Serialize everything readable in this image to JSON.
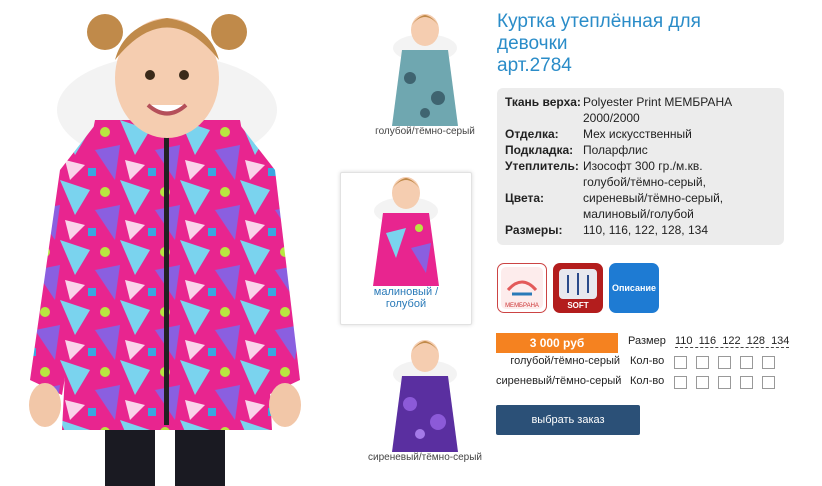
{
  "product": {
    "title_line1": "Куртка утеплённая для",
    "title_line2": "девочки",
    "article": "арт.2784"
  },
  "specs": [
    {
      "key": "Ткань верха:",
      "value": "Polyester Print МЕМБРАНА 2000/2000"
    },
    {
      "key": "Отделка:",
      "value": "Мех искусственный"
    },
    {
      "key": "Подкладка:",
      "value": "Поларфлис"
    },
    {
      "key": "Утеплитель:",
      "value": "Изософт 300 гр./м.кв."
    },
    {
      "key": "Цвета:",
      "value": "голубой/тёмно-серый, сиреневый/тёмно-серый, малиновый/голубой"
    },
    {
      "key": "Размеры:",
      "value": "110, 116, 122, 128, 134"
    }
  ],
  "thumbnails": [
    {
      "caption": "голубой/тёмно-серый",
      "icon": "jacket-blue-grey-photo"
    },
    {
      "caption": "малиновый / голубой",
      "icon": "jacket-raspberry-photo"
    },
    {
      "caption": "сиреневый/тёмно-серый",
      "icon": "jacket-lilac-photo"
    }
  ],
  "badges": {
    "membrana": "МЕМБРАНА",
    "isosoft": "SOFT",
    "description": "Описание"
  },
  "order": {
    "price": "3 000 руб",
    "size_label": "Размер",
    "sizes": [
      "110",
      "116",
      "122",
      "128",
      "134"
    ],
    "rows": [
      {
        "color": "голубой/тёмно-серый",
        "qty_label": "Кол-во"
      },
      {
        "color": "сиреневый/тёмно-серый",
        "qty_label": "Кол-во"
      }
    ],
    "button": "выбрать заказ"
  },
  "colors": {
    "title": "#2a8cc8",
    "price_bg": "#f58220",
    "button_bg": "#2b5077",
    "jacket_pink": "#e8258f",
    "jacket_blue": "#6fa7b0",
    "jacket_purple": "#5a2fa0"
  }
}
